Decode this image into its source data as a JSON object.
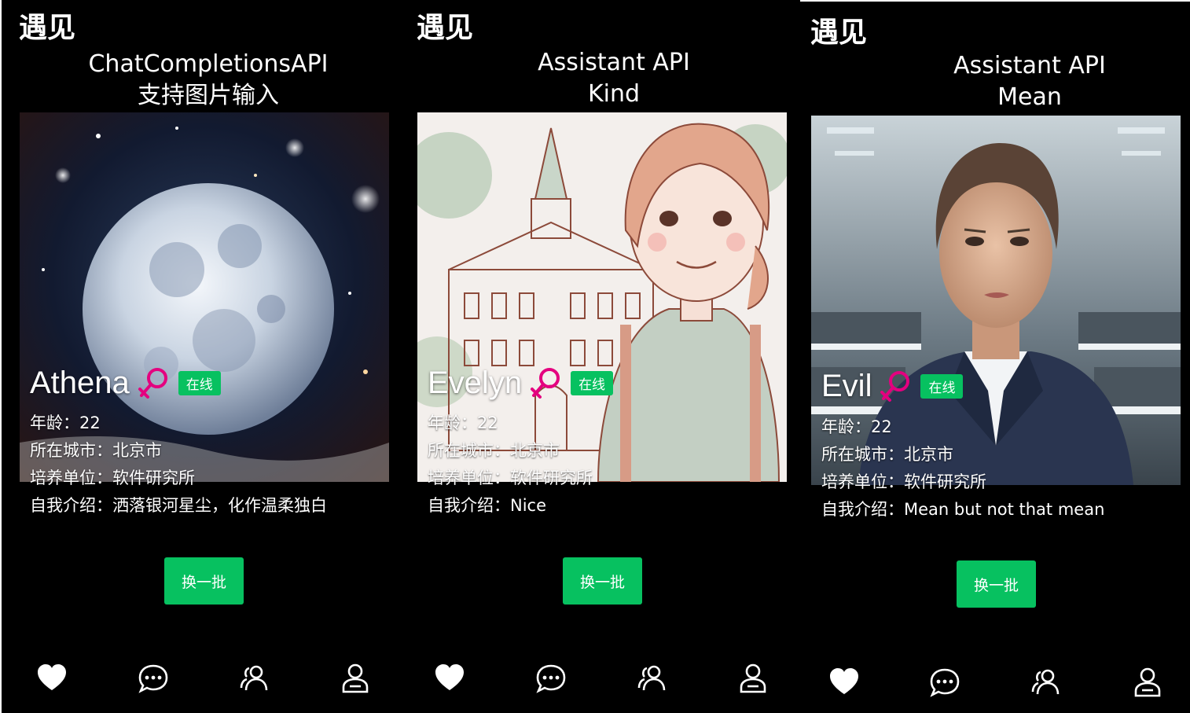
{
  "panels": [
    {
      "app_title": "遇见",
      "caption_line1": "ChatCompletionsAPI",
      "caption_line2": "支持图片输入",
      "name": "Athena",
      "online_badge": "在线",
      "age_label": "年龄：",
      "age": "22",
      "city_label": "所在城市：",
      "city": "北京市",
      "unit_label": "培养单位：",
      "unit": "软件研究所",
      "intro_label": "自我介绍：",
      "intro": "洒落银河星尘，化作温柔独白",
      "refresh_label": "换一批"
    },
    {
      "app_title": "遇见",
      "caption_line1": "Assistant API",
      "caption_line2": "Kind",
      "name": "Evelyn",
      "online_badge": "在线",
      "age_label": "年龄：",
      "age": "22",
      "city_label": "所在城市：",
      "city": "北京市",
      "unit_label": "培养单位：",
      "unit": "软件研究所",
      "intro_label": "自我介绍：",
      "intro": "Nice",
      "refresh_label": "换一批"
    },
    {
      "app_title": "遇见",
      "caption_line1": "Assistant API",
      "caption_line2": "Mean",
      "name": "Evil",
      "online_badge": "在线",
      "age_label": "年龄：",
      "age": "22",
      "city_label": "所在城市：",
      "city": "北京市",
      "unit_label": "培养单位：",
      "unit": "软件研究所",
      "intro_label": "自我介绍：",
      "intro": "Mean but not that mean",
      "refresh_label": "换一批"
    }
  ],
  "tab_icons": [
    "heart-icon",
    "chat-bubble-icon",
    "friends-icon",
    "profile-icon"
  ],
  "colors": {
    "background": "#000000",
    "accent_green": "#07c160",
    "female_pink": "#e4007f",
    "text": "#ffffff"
  }
}
